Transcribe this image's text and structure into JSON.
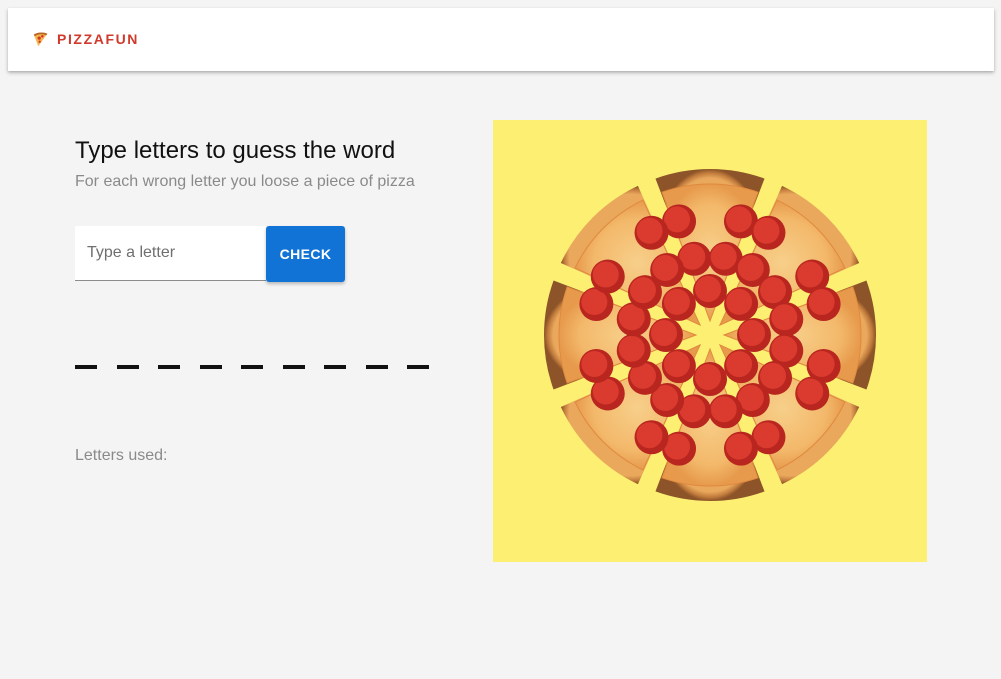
{
  "header": {
    "logo_text": "PIZZAFUN",
    "logo_icon": "pizza-slice-icon",
    "brand_color": "#d03a2c"
  },
  "game": {
    "title": "Type letters to guess the word",
    "subtitle": "For each wrong letter you loose a piece of pizza",
    "input_placeholder": "Type a letter",
    "input_value": "",
    "check_label": "CHECK",
    "word_length": 9,
    "letters_used_label": "Letters used:",
    "letters_used": ""
  },
  "pizza": {
    "slices_remaining": 8,
    "background_color": "#fcef72"
  },
  "colors": {
    "accent": "#1273d6",
    "page_background": "#f4f4f4"
  }
}
